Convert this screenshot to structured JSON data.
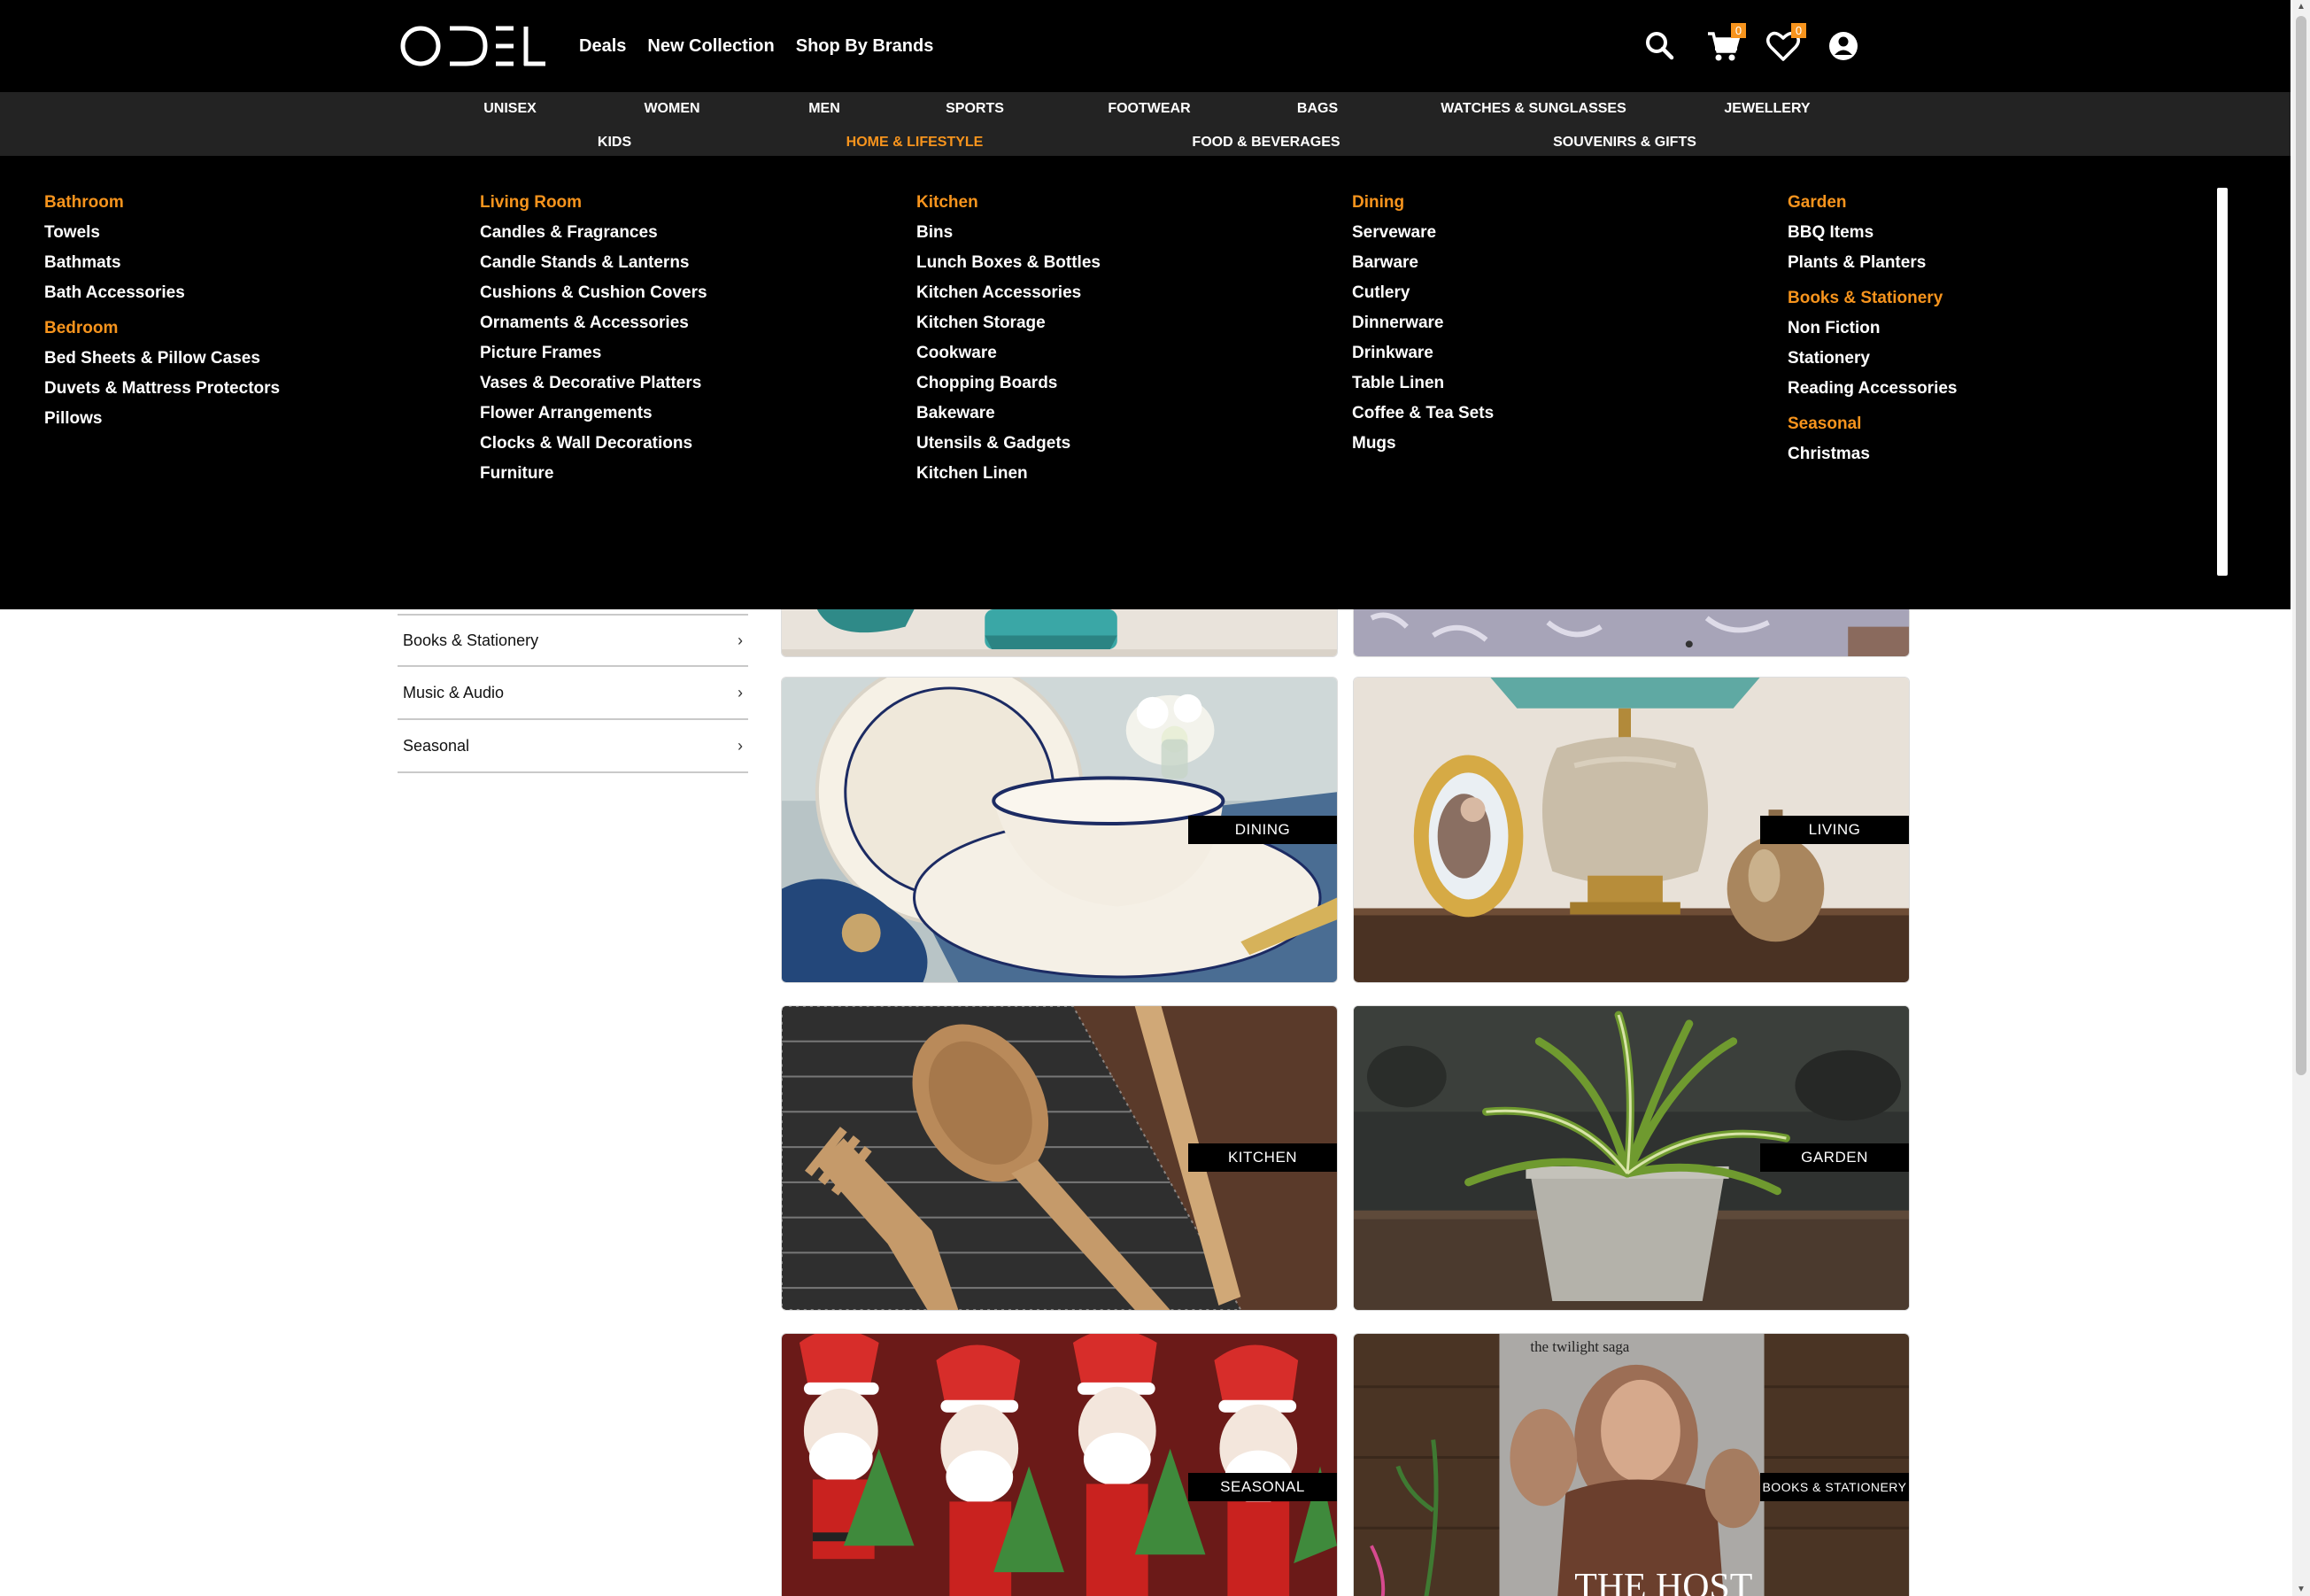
{
  "header": {
    "logo_text": "ODEL",
    "nav": [
      "Deals",
      "New Collection",
      "Shop By Brands"
    ],
    "cart_count": "0",
    "wishlist_count": "0",
    "icons": [
      "search-icon",
      "cart-icon",
      "heart-icon",
      "user-icon"
    ]
  },
  "categories": {
    "row1": [
      "UNISEX",
      "WOMEN",
      "MEN",
      "SPORTS",
      "FOOTWEAR",
      "BAGS",
      "WATCHES & SUNGLASSES",
      "JEWELLERY"
    ],
    "row2": [
      "KIDS",
      "HOME & LIFESTYLE",
      "FOOD & BEVERAGES",
      "SOUVENIRS & GIFTS"
    ],
    "active": "HOME & LIFESTYLE"
  },
  "mega": {
    "col1": [
      {
        "heading": "Bathroom",
        "items": [
          "Towels",
          "Bathmats",
          "Bath Accessories"
        ]
      },
      {
        "heading": "Bedroom",
        "items": [
          "Bed Sheets & Pillow Cases",
          "Duvets & Mattress Protectors",
          "Pillows"
        ]
      }
    ],
    "col2": [
      {
        "heading": "Living Room",
        "items": [
          "Candles & Fragrances",
          "Candle Stands & Lanterns",
          "Cushions & Cushion Covers",
          "Ornaments & Accessories",
          "Picture Frames",
          "Vases & Decorative Platters",
          "Flower Arrangements",
          "Clocks & Wall Decorations",
          "Furniture"
        ]
      }
    ],
    "col3": [
      {
        "heading": "Kitchen",
        "items": [
          "Bins",
          "Lunch Boxes & Bottles",
          "Kitchen Accessories",
          "Kitchen Storage",
          "Cookware",
          "Chopping Boards",
          "Bakeware",
          "Utensils & Gadgets",
          "Kitchen Linen"
        ]
      }
    ],
    "col4": [
      {
        "heading": "Dining",
        "items": [
          "Serveware",
          "Barware",
          "Cutlery",
          "Dinnerware",
          "Drinkware",
          "Table Linen",
          "Coffee & Tea Sets",
          "Mugs"
        ]
      }
    ],
    "col5": [
      {
        "heading": "Garden",
        "items": [
          "BBQ Items",
          "Plants & Planters"
        ]
      },
      {
        "heading": "Books & Stationery",
        "items": [
          "Non Fiction",
          "Stationery",
          "Reading Accessories"
        ]
      },
      {
        "heading": "Seasonal",
        "items": [
          "Christmas"
        ]
      }
    ]
  },
  "sidebar": {
    "items": [
      "Books & Stationery",
      "Music & Audio",
      "Seasonal"
    ],
    "chevron": "›"
  },
  "tiles": {
    "dining": "DINING",
    "living": "LIVING",
    "kitchen": "KITCHEN",
    "garden": "GARDEN",
    "seasonal": "SEASONAL",
    "books": "BOOKS & STATIONERY",
    "book_cover_top": "the twilight saga",
    "book_cover_title": "THE HOST"
  },
  "colors": {
    "accent": "#f7941d",
    "header_bg": "#000000",
    "catbar_bg": "#232323"
  }
}
